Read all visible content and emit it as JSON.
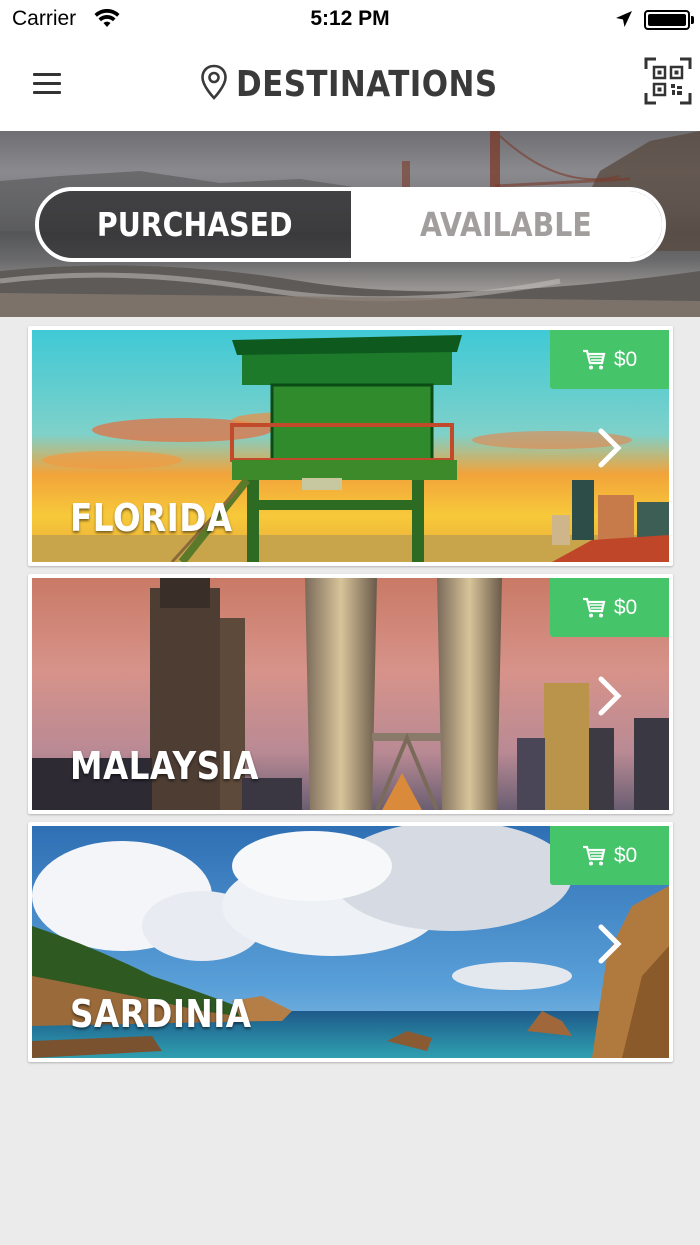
{
  "status_bar": {
    "carrier": "Carrier",
    "time": "5:12 PM",
    "icons": [
      "wifi-icon",
      "location-arrow-icon",
      "battery-icon"
    ]
  },
  "nav": {
    "title": "DESTINATIONS",
    "icons": [
      "menu-icon",
      "map-pin-icon",
      "qr-code-icon"
    ]
  },
  "segments": {
    "active": "PURCHASED",
    "inactive": "AVAILABLE"
  },
  "destinations": [
    {
      "name": "FLORIDA",
      "price": "$0",
      "badge_icon": "cart-icon"
    },
    {
      "name": "MALAYSIA",
      "price": "$0",
      "badge_icon": "cart-icon"
    },
    {
      "name": "SARDINIA",
      "price": "$0",
      "badge_icon": "cart-icon"
    }
  ],
  "colors": {
    "badge_green": "#45c46a",
    "title_text": "#3a3a3a",
    "inactive_segment_text": "#a39e9e",
    "page_background": "#ebebeb"
  }
}
